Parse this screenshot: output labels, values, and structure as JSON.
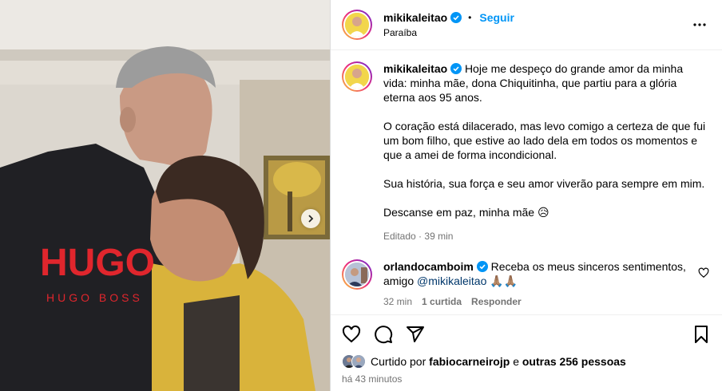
{
  "post": {
    "username": "mikikaleitao",
    "follow_label": "Seguir",
    "separator": "•",
    "location": "Paraíba",
    "more_icon": "more-horizontal-icon"
  },
  "caption": {
    "username": "mikikaleitao",
    "paragraphs": [
      "Hoje me despeço do grande amor da minha vida: minha mãe, dona Chiquitinha, que partiu para a glória eterna aos 95 anos.",
      "O coração está dilacerado, mas levo comigo a certeza de que fui um bom filho, que estive ao lado dela em todos os momentos e que a amei de forma incondicional.",
      "Sua história, sua força e seu amor viverão para sempre em mim.",
      "Descanse em paz, minha mãe 😥"
    ],
    "edited": "Editado",
    "meta_sep": "·",
    "time": "39 min"
  },
  "comment": {
    "username": "orlandocamboim",
    "text": "Receba os meus sinceros sentimentos, amigo",
    "mention": "@mikikaleitao",
    "emoji": "🙏🏽🙏🏽",
    "time": "32 min",
    "likes": "1 curtida",
    "reply": "Responder"
  },
  "likes": {
    "prefix": "Curtido por",
    "user": "fabiocarneirojp",
    "middle": "e",
    "others": "outras 256 pessoas"
  },
  "timestamp": "há 43 minutos",
  "photo": {
    "shirt_text_main": "HUGO",
    "shirt_text_sub": "HUGO BOSS"
  },
  "colors": {
    "accent": "#0095f6",
    "verified": "#0095f6",
    "muted": "#737373",
    "mention": "#00376b"
  }
}
